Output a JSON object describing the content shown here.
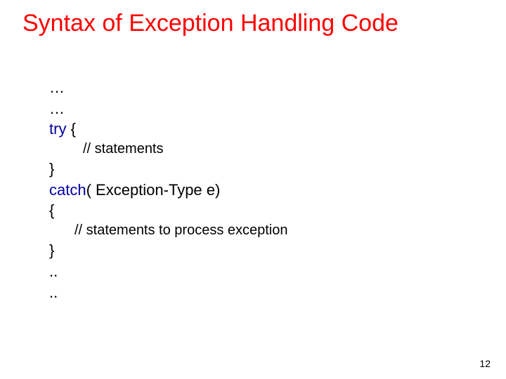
{
  "title": "Syntax of Exception Handling Code",
  "code": {
    "l1": "…",
    "l2": "…",
    "l3_a": "try",
    "l3_b": " {",
    "l4": "// statements",
    "l5": "}",
    "l6_a": "catch",
    "l6_b": "( Exception-Type e)",
    "l7": "{",
    "l8": "// statements to process exception",
    "l9": "}",
    "l10": "..",
    "l11": ".."
  },
  "page_number": "12"
}
